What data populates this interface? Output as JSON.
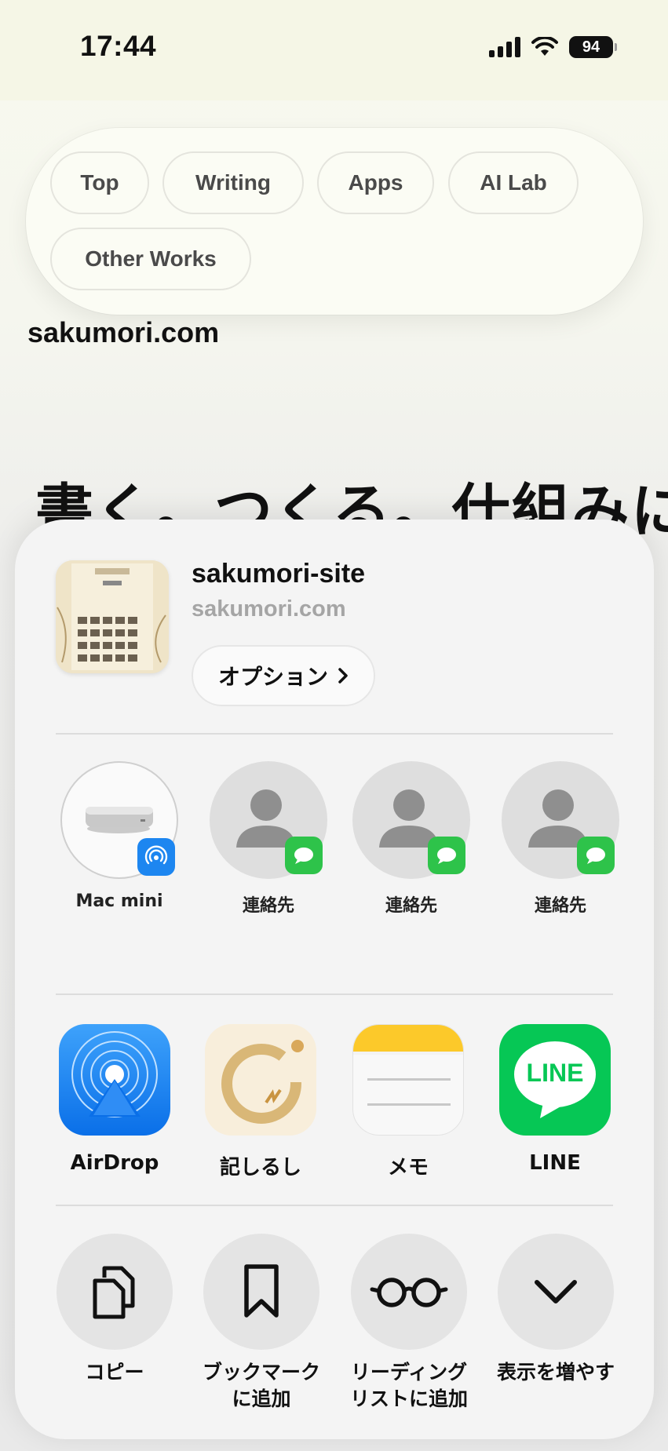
{
  "status_bar": {
    "time": "17:44",
    "battery": "94"
  },
  "nav": {
    "items": [
      "Top",
      "Writing",
      "Apps",
      "AI Lab",
      "Other Works"
    ]
  },
  "site": {
    "name": "sakumori.com",
    "hero": "書く。つくる。仕組みに"
  },
  "share": {
    "title": "sakumori-site",
    "subtitle": "sakumori.com",
    "options_label": "オプション",
    "people": [
      {
        "label": "Mac mini",
        "badge": "airdrop-badge"
      },
      {
        "label": "連絡先",
        "badge": "messages-badge"
      },
      {
        "label": "連絡先",
        "badge": "messages-badge"
      },
      {
        "label": "連絡先",
        "badge": "messages-badge"
      }
    ],
    "apps": [
      {
        "label": "AirDrop",
        "icon": "airdrop-icon"
      },
      {
        "label": "記しるし",
        "icon": "shirushi-app-icon"
      },
      {
        "label": "メモ",
        "icon": "notes-icon"
      },
      {
        "label": "LINE",
        "icon": "line-icon",
        "icon_text": "LINE"
      }
    ],
    "actions": [
      {
        "label": "コピー",
        "icon": "copy-icon"
      },
      {
        "label": "ブックマーク\nに追加",
        "icon": "bookmark-icon"
      },
      {
        "label": "リーディング\nリストに追加",
        "icon": "glasses-icon"
      },
      {
        "label": "表示を増やす",
        "icon": "chevron-down-icon"
      }
    ]
  },
  "colors": {
    "messages_green": "#2ec34a",
    "airdrop_blue": "#1d86f0",
    "line_green": "#06c755"
  }
}
